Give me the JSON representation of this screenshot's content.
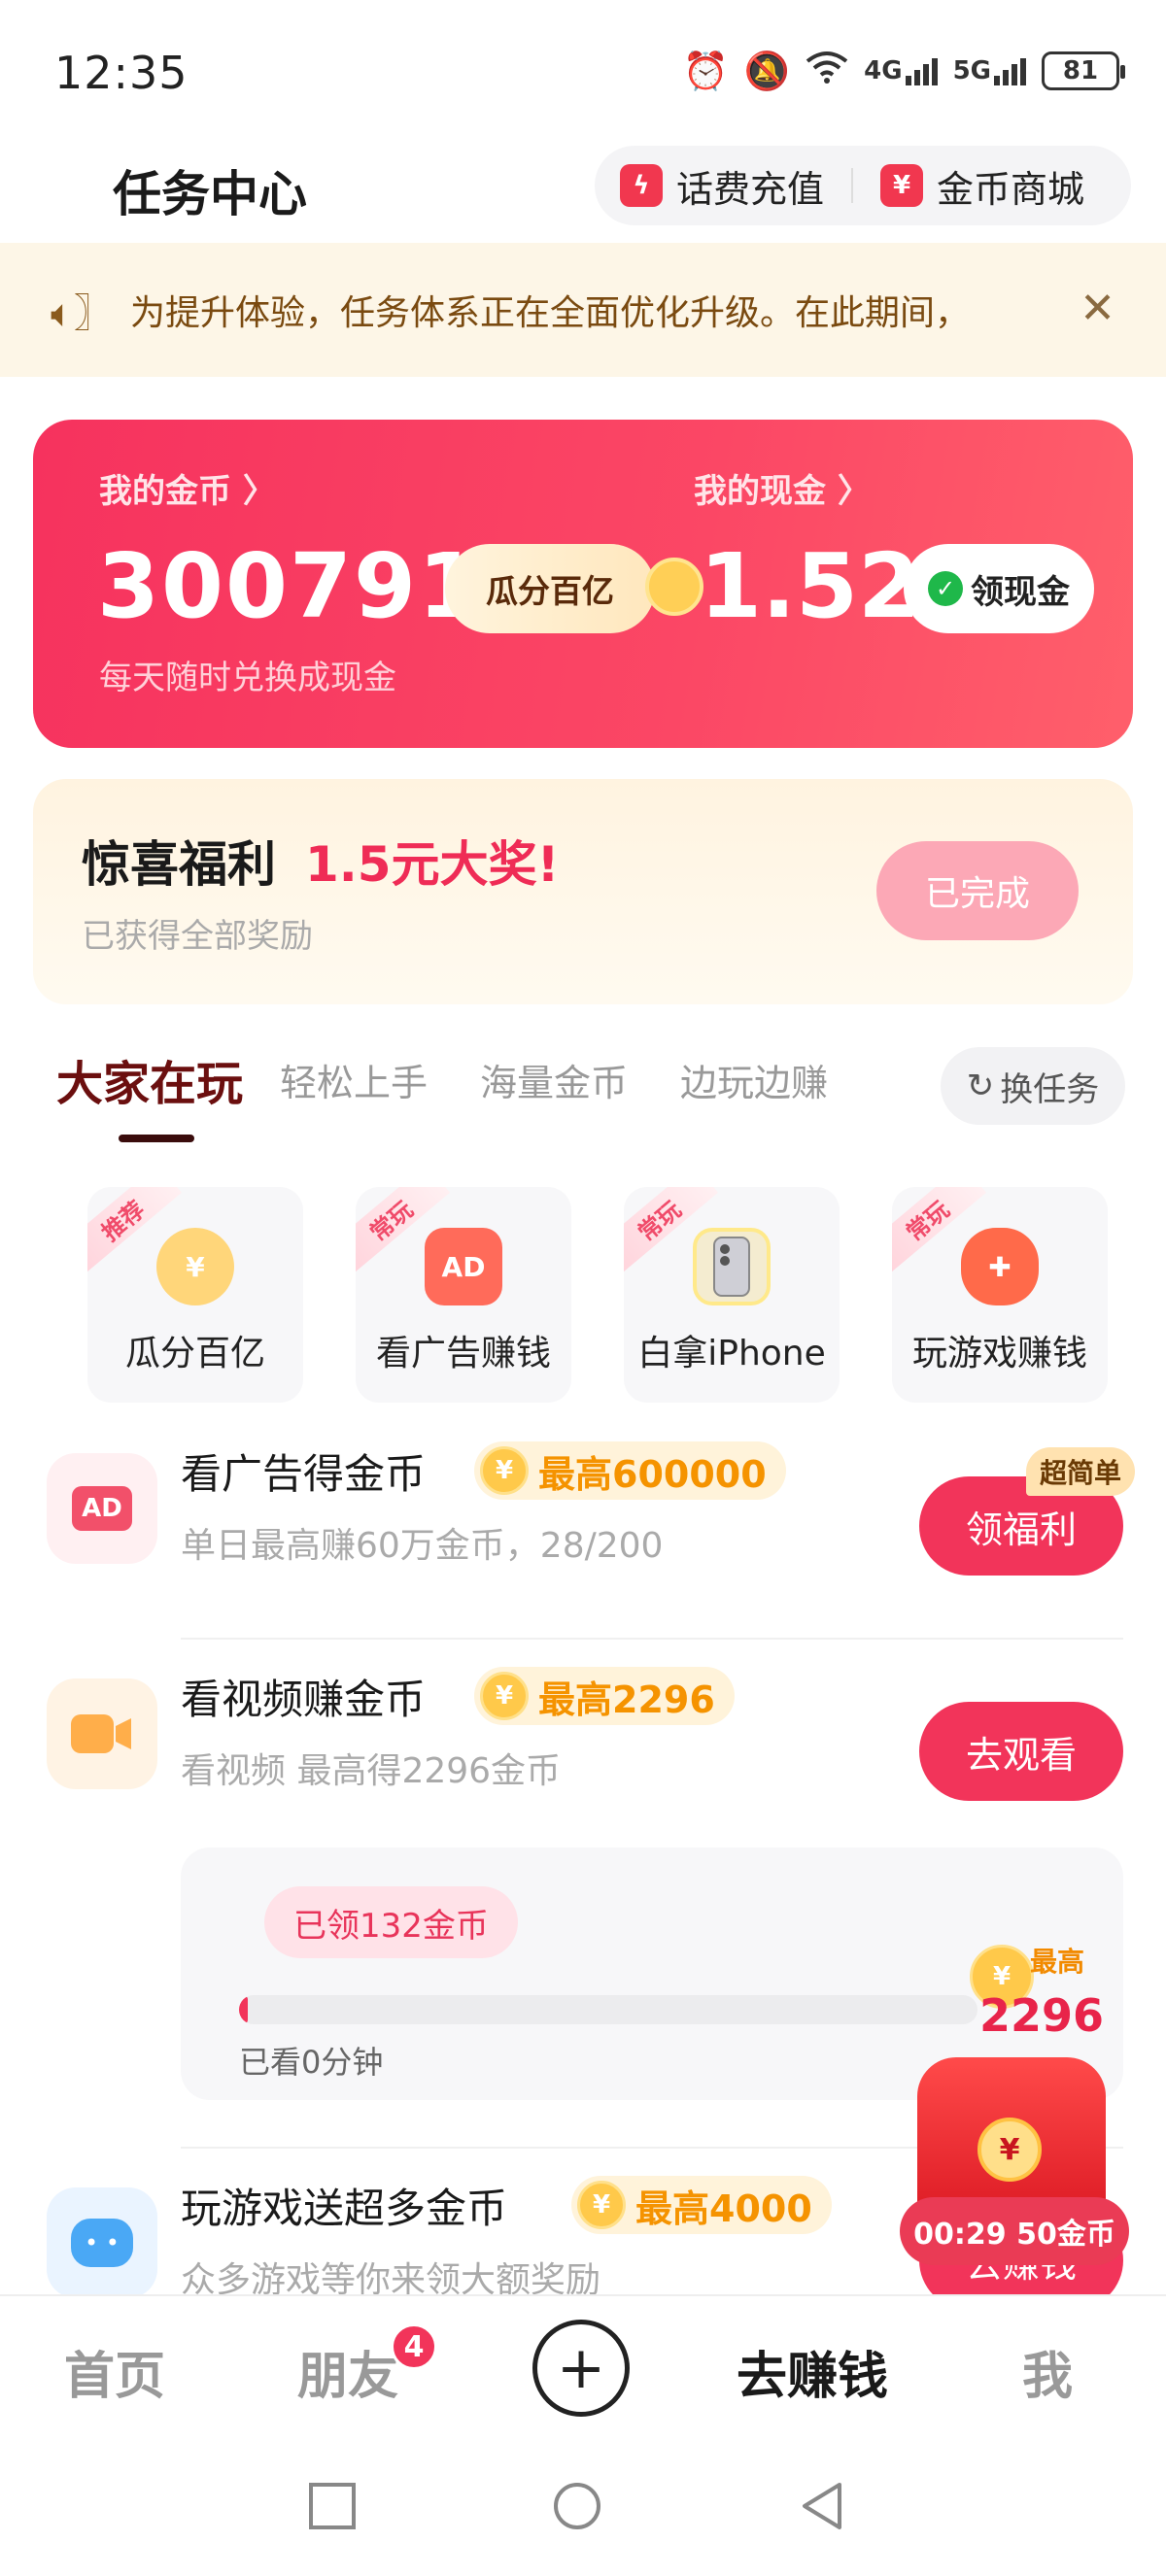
{
  "status_bar": {
    "time": "12:35",
    "network_1": "4G",
    "network_2": "5G",
    "battery": "81"
  },
  "header": {
    "title": "任务中心",
    "recharge_label": "话费充值",
    "mall_label": "金币商城",
    "recharge_icon": "lightning-icon",
    "mall_icon": "ticket-icon"
  },
  "notice": {
    "text": "为提升体验，任务体系正在全面优化升级。在此期间，",
    "icon": "speaker-icon"
  },
  "wallet": {
    "coins_label": "我的金币 〉",
    "coins_value": "300791",
    "guafen_label": "瓜分百亿",
    "cash_label": "我的现金 〉",
    "cash_value": "1.52",
    "withdraw_label": "领现金",
    "subtitle": "每天随时兑换成现金"
  },
  "surprise": {
    "title": "惊喜福利",
    "prize": "1.5元大奖!",
    "subtitle": "已获得全部奖励",
    "button": "已完成"
  },
  "tabs": [
    {
      "label": "大家在玩",
      "active": true
    },
    {
      "label": "轻松上手",
      "active": false
    },
    {
      "label": "海量金币",
      "active": false
    },
    {
      "label": "边玩边赚",
      "active": false
    }
  ],
  "swap_label": "换任务",
  "tiles": [
    {
      "tag": "推荐",
      "label": "瓜分百亿",
      "icon": "hand-coin-icon"
    },
    {
      "tag": "常玩",
      "label": "看广告赚钱",
      "icon": "tv-ad-icon"
    },
    {
      "tag": "常玩",
      "label": "白拿iPhone",
      "icon": "iphone-icon"
    },
    {
      "tag": "常玩",
      "label": "玩游戏赚钱",
      "icon": "gamepad-icon"
    }
  ],
  "tasks": [
    {
      "title": "看广告得金币",
      "badge": "最高600000",
      "subtitle": "单日最高赚60万金币，28/200",
      "button": "领福利",
      "tag": "超简单",
      "icon": "ad-icon"
    },
    {
      "title": "看视频赚金币",
      "badge": "最高2296",
      "subtitle": "看视频 最高得2296金币",
      "button": "去观看",
      "icon": "video-icon"
    },
    {
      "title": "玩游戏送超多金币",
      "badge": "最高4000",
      "subtitle": "众多游戏等你来领大额奖励",
      "button": "去赚钱",
      "icon": "game-robot-icon"
    }
  ],
  "video_progress": {
    "claimed": "已领132金币",
    "watched": "已看0分钟",
    "progress": 0.01,
    "max_label": "最高",
    "max_value": "2296"
  },
  "floating": {
    "timer": "00:29 50金币"
  },
  "bottom_nav": {
    "home": "首页",
    "friends": "朋友",
    "friends_badge": "4",
    "plus": "+",
    "earn": "去赚钱",
    "me": "我"
  },
  "colors": {
    "primary": "#f2345a",
    "accent_orange": "#f59300",
    "notice_bg": "#fdf6e7"
  }
}
